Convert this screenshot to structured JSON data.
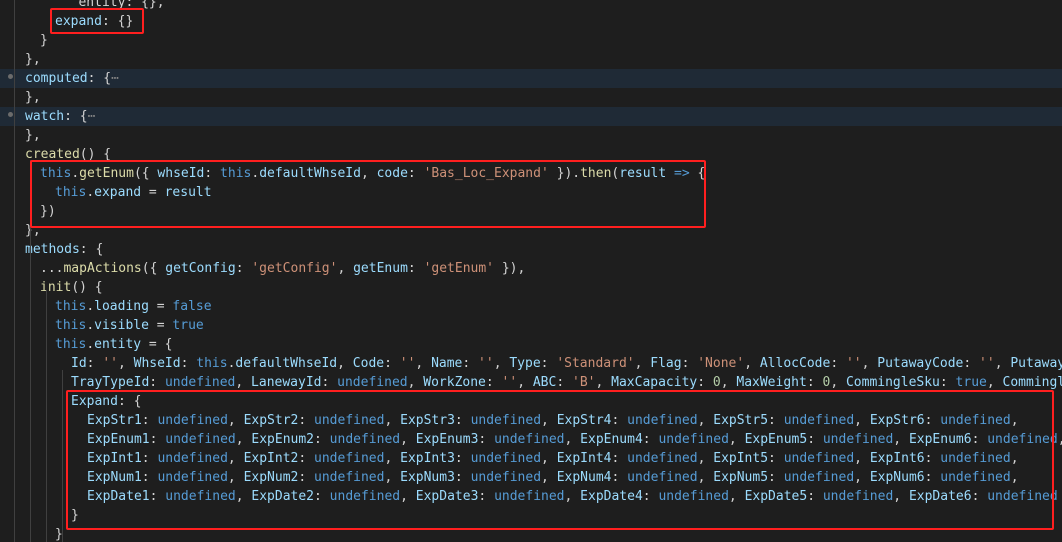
{
  "lines": [
    [
      [
        "   entity: {},",
        "pun"
      ]
    ],
    [
      [
        "expand",
        "prop"
      ],
      [
        ": {}",
        "pun"
      ]
    ],
    [
      [
        "}",
        "pun"
      ]
    ],
    [
      [
        "},",
        "pun"
      ]
    ],
    [
      [
        "computed",
        "prop"
      ],
      [
        ": {",
        "pun"
      ],
      [
        "⋯",
        "gray"
      ]
    ],
    [
      [
        "},",
        "pun"
      ]
    ],
    [
      [
        "watch",
        "prop"
      ],
      [
        ": {",
        "pun"
      ],
      [
        "⋯",
        "gray"
      ]
    ],
    [
      [
        "},",
        "pun"
      ]
    ],
    [
      [
        "created",
        "fn"
      ],
      [
        "() {",
        "pun"
      ]
    ],
    [
      [
        "this",
        "kw"
      ],
      [
        ".",
        "pun"
      ],
      [
        "getEnum",
        "fn"
      ],
      [
        "({ ",
        "pun"
      ],
      [
        "whseId",
        "prop"
      ],
      [
        ": ",
        "pun"
      ],
      [
        "this",
        "kw"
      ],
      [
        ".",
        "pun"
      ],
      [
        "defaultWhseId",
        "prop"
      ],
      [
        ", ",
        "pun"
      ],
      [
        "code",
        "prop"
      ],
      [
        ": ",
        "pun"
      ],
      [
        "'Bas_Loc_Expand'",
        "str"
      ],
      [
        " }).",
        "pun"
      ],
      [
        "then",
        "fn"
      ],
      [
        "(",
        "pun"
      ],
      [
        "result",
        "prop"
      ],
      [
        " ",
        "pun"
      ],
      [
        "=>",
        "kw"
      ],
      [
        " {",
        "pun"
      ]
    ],
    [
      [
        "this",
        "kw"
      ],
      [
        ".",
        "pun"
      ],
      [
        "expand",
        "prop"
      ],
      [
        " = ",
        "pun"
      ],
      [
        "result",
        "prop"
      ]
    ],
    [
      [
        "})",
        "pun"
      ]
    ],
    [
      [
        "},",
        "pun"
      ]
    ],
    [
      [
        "methods",
        "prop"
      ],
      [
        ": {",
        "pun"
      ]
    ],
    [
      [
        "...",
        "pun"
      ],
      [
        "mapActions",
        "fn"
      ],
      [
        "({ ",
        "pun"
      ],
      [
        "getConfig",
        "prop"
      ],
      [
        ": ",
        "pun"
      ],
      [
        "'getConfig'",
        "str"
      ],
      [
        ", ",
        "pun"
      ],
      [
        "getEnum",
        "prop"
      ],
      [
        ": ",
        "pun"
      ],
      [
        "'getEnum'",
        "str"
      ],
      [
        " }),",
        "pun"
      ]
    ],
    [
      [
        "init",
        "fn"
      ],
      [
        "() {",
        "pun"
      ]
    ],
    [
      [
        "this",
        "kw"
      ],
      [
        ".",
        "pun"
      ],
      [
        "loading",
        "prop"
      ],
      [
        " = ",
        "pun"
      ],
      [
        "false",
        "kw"
      ]
    ],
    [
      [
        "this",
        "kw"
      ],
      [
        ".",
        "pun"
      ],
      [
        "visible",
        "prop"
      ],
      [
        " = ",
        "pun"
      ],
      [
        "true",
        "kw"
      ]
    ],
    [
      [
        "this",
        "kw"
      ],
      [
        ".",
        "pun"
      ],
      [
        "entity",
        "prop"
      ],
      [
        " = {",
        "pun"
      ]
    ],
    [
      [
        "Id",
        "prop"
      ],
      [
        ": ",
        "pun"
      ],
      [
        "''",
        "str"
      ],
      [
        ", ",
        "pun"
      ],
      [
        "WhseId",
        "prop"
      ],
      [
        ": ",
        "pun"
      ],
      [
        "this",
        "kw"
      ],
      [
        ".",
        "pun"
      ],
      [
        "defaultWhseId",
        "prop"
      ],
      [
        ", ",
        "pun"
      ],
      [
        "Code",
        "prop"
      ],
      [
        ": ",
        "pun"
      ],
      [
        "''",
        "str"
      ],
      [
        ", ",
        "pun"
      ],
      [
        "Name",
        "prop"
      ],
      [
        ": ",
        "pun"
      ],
      [
        "''",
        "str"
      ],
      [
        ", ",
        "pun"
      ],
      [
        "Type",
        "prop"
      ],
      [
        ": ",
        "pun"
      ],
      [
        "'Standard'",
        "str"
      ],
      [
        ", ",
        "pun"
      ],
      [
        "Flag",
        "prop"
      ],
      [
        ": ",
        "pun"
      ],
      [
        "'None'",
        "str"
      ],
      [
        ", ",
        "pun"
      ],
      [
        "AllocCode",
        "prop"
      ],
      [
        ": ",
        "pun"
      ],
      [
        "''",
        "str"
      ],
      [
        ", ",
        "pun"
      ],
      [
        "PutawayCode",
        "prop"
      ],
      [
        ": ",
        "pun"
      ],
      [
        "''",
        "str"
      ],
      [
        ", ",
        "pun"
      ],
      [
        "PutawayZo",
        "prop"
      ]
    ],
    [
      [
        "TrayTypeId",
        "prop"
      ],
      [
        ": ",
        "pun"
      ],
      [
        "undefined",
        "kw"
      ],
      [
        ", ",
        "pun"
      ],
      [
        "LanewayId",
        "prop"
      ],
      [
        ": ",
        "pun"
      ],
      [
        "undefined",
        "kw"
      ],
      [
        ", ",
        "pun"
      ],
      [
        "WorkZone",
        "prop"
      ],
      [
        ": ",
        "pun"
      ],
      [
        "''",
        "str"
      ],
      [
        ", ",
        "pun"
      ],
      [
        "ABC",
        "prop"
      ],
      [
        ": ",
        "pun"
      ],
      [
        "'B'",
        "str"
      ],
      [
        ", ",
        "pun"
      ],
      [
        "MaxCapacity",
        "prop"
      ],
      [
        ": ",
        "pun"
      ],
      [
        "0",
        "num"
      ],
      [
        ", ",
        "pun"
      ],
      [
        "MaxWeight",
        "prop"
      ],
      [
        ": ",
        "pun"
      ],
      [
        "0",
        "num"
      ],
      [
        ", ",
        "pun"
      ],
      [
        "CommingleSku",
        "prop"
      ],
      [
        ": ",
        "pun"
      ],
      [
        "true",
        "kw"
      ],
      [
        ", ",
        "pun"
      ],
      [
        "CommingleL",
        "prop"
      ]
    ],
    [
      [
        "Expand",
        "prop"
      ],
      [
        ": {",
        "pun"
      ]
    ],
    [
      [
        "ExpStr1",
        "prop"
      ],
      [
        ": ",
        "pun"
      ],
      [
        "undefined",
        "kw"
      ],
      [
        ", ",
        "pun"
      ],
      [
        "ExpStr2",
        "prop"
      ],
      [
        ": ",
        "pun"
      ],
      [
        "undefined",
        "kw"
      ],
      [
        ", ",
        "pun"
      ],
      [
        "ExpStr3",
        "prop"
      ],
      [
        ": ",
        "pun"
      ],
      [
        "undefined",
        "kw"
      ],
      [
        ", ",
        "pun"
      ],
      [
        "ExpStr4",
        "prop"
      ],
      [
        ": ",
        "pun"
      ],
      [
        "undefined",
        "kw"
      ],
      [
        ", ",
        "pun"
      ],
      [
        "ExpStr5",
        "prop"
      ],
      [
        ": ",
        "pun"
      ],
      [
        "undefined",
        "kw"
      ],
      [
        ", ",
        "pun"
      ],
      [
        "ExpStr6",
        "prop"
      ],
      [
        ": ",
        "pun"
      ],
      [
        "undefined",
        "kw"
      ],
      [
        ",",
        "pun"
      ]
    ],
    [
      [
        "ExpEnum1",
        "prop"
      ],
      [
        ": ",
        "pun"
      ],
      [
        "undefined",
        "kw"
      ],
      [
        ", ",
        "pun"
      ],
      [
        "ExpEnum2",
        "prop"
      ],
      [
        ": ",
        "pun"
      ],
      [
        "undefined",
        "kw"
      ],
      [
        ", ",
        "pun"
      ],
      [
        "ExpEnum3",
        "prop"
      ],
      [
        ": ",
        "pun"
      ],
      [
        "undefined",
        "kw"
      ],
      [
        ", ",
        "pun"
      ],
      [
        "ExpEnum4",
        "prop"
      ],
      [
        ": ",
        "pun"
      ],
      [
        "undefined",
        "kw"
      ],
      [
        ", ",
        "pun"
      ],
      [
        "ExpEnum5",
        "prop"
      ],
      [
        ": ",
        "pun"
      ],
      [
        "undefined",
        "kw"
      ],
      [
        ", ",
        "pun"
      ],
      [
        "ExpEnum6",
        "prop"
      ],
      [
        ": ",
        "pun"
      ],
      [
        "undefined",
        "kw"
      ],
      [
        ",",
        "pun"
      ]
    ],
    [
      [
        "ExpInt1",
        "prop"
      ],
      [
        ": ",
        "pun"
      ],
      [
        "undefined",
        "kw"
      ],
      [
        ", ",
        "pun"
      ],
      [
        "ExpInt2",
        "prop"
      ],
      [
        ": ",
        "pun"
      ],
      [
        "undefined",
        "kw"
      ],
      [
        ", ",
        "pun"
      ],
      [
        "ExpInt3",
        "prop"
      ],
      [
        ": ",
        "pun"
      ],
      [
        "undefined",
        "kw"
      ],
      [
        ", ",
        "pun"
      ],
      [
        "ExpInt4",
        "prop"
      ],
      [
        ": ",
        "pun"
      ],
      [
        "undefined",
        "kw"
      ],
      [
        ", ",
        "pun"
      ],
      [
        "ExpInt5",
        "prop"
      ],
      [
        ": ",
        "pun"
      ],
      [
        "undefined",
        "kw"
      ],
      [
        ", ",
        "pun"
      ],
      [
        "ExpInt6",
        "prop"
      ],
      [
        ": ",
        "pun"
      ],
      [
        "undefined",
        "kw"
      ],
      [
        ",",
        "pun"
      ]
    ],
    [
      [
        "ExpNum1",
        "prop"
      ],
      [
        ": ",
        "pun"
      ],
      [
        "undefined",
        "kw"
      ],
      [
        ", ",
        "pun"
      ],
      [
        "ExpNum2",
        "prop"
      ],
      [
        ": ",
        "pun"
      ],
      [
        "undefined",
        "kw"
      ],
      [
        ", ",
        "pun"
      ],
      [
        "ExpNum3",
        "prop"
      ],
      [
        ": ",
        "pun"
      ],
      [
        "undefined",
        "kw"
      ],
      [
        ", ",
        "pun"
      ],
      [
        "ExpNum4",
        "prop"
      ],
      [
        ": ",
        "pun"
      ],
      [
        "undefined",
        "kw"
      ],
      [
        ", ",
        "pun"
      ],
      [
        "ExpNum5",
        "prop"
      ],
      [
        ": ",
        "pun"
      ],
      [
        "undefined",
        "kw"
      ],
      [
        ", ",
        "pun"
      ],
      [
        "ExpNum6",
        "prop"
      ],
      [
        ": ",
        "pun"
      ],
      [
        "undefined",
        "kw"
      ],
      [
        ",",
        "pun"
      ]
    ],
    [
      [
        "ExpDate1",
        "prop"
      ],
      [
        ": ",
        "pun"
      ],
      [
        "undefined",
        "kw"
      ],
      [
        ", ",
        "pun"
      ],
      [
        "ExpDate2",
        "prop"
      ],
      [
        ": ",
        "pun"
      ],
      [
        "undefined",
        "kw"
      ],
      [
        ", ",
        "pun"
      ],
      [
        "ExpDate3",
        "prop"
      ],
      [
        ": ",
        "pun"
      ],
      [
        "undefined",
        "kw"
      ],
      [
        ", ",
        "pun"
      ],
      [
        "ExpDate4",
        "prop"
      ],
      [
        ": ",
        "pun"
      ],
      [
        "undefined",
        "kw"
      ],
      [
        ", ",
        "pun"
      ],
      [
        "ExpDate5",
        "prop"
      ],
      [
        ": ",
        "pun"
      ],
      [
        "undefined",
        "kw"
      ],
      [
        ", ",
        "pun"
      ],
      [
        "ExpDate6",
        "prop"
      ],
      [
        ": ",
        "pun"
      ],
      [
        "undefined",
        "kw"
      ]
    ],
    [
      [
        "}",
        "pun"
      ]
    ],
    [
      [
        "}",
        "pun"
      ]
    ]
  ],
  "colors": {
    "background": "#1e1e1e",
    "highlight_annotation": "#ff1f1f",
    "keyword": "#569cd6",
    "property": "#9cdcfe",
    "string": "#ce9178",
    "function": "#dcdcaa"
  }
}
